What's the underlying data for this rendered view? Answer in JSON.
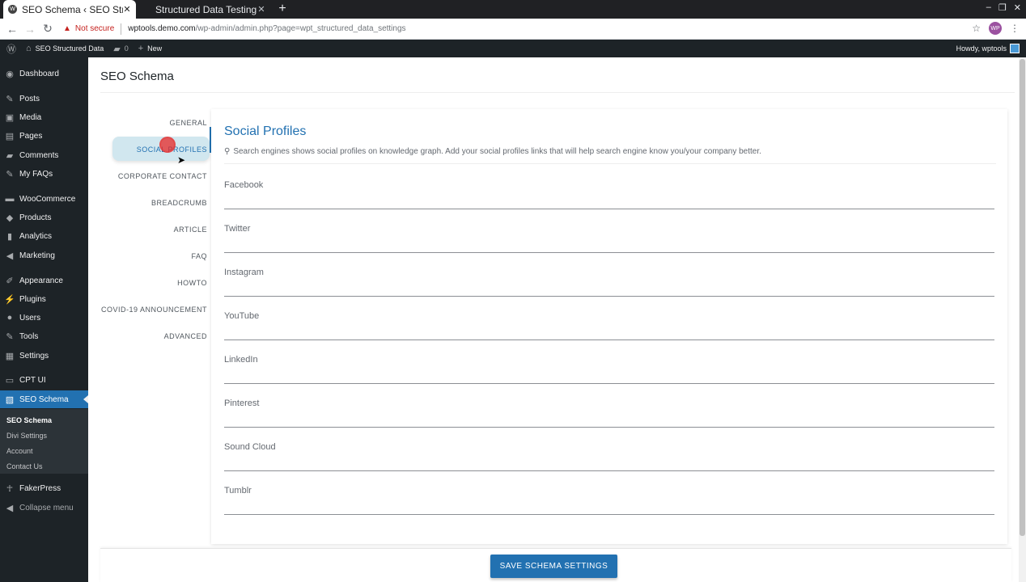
{
  "browser": {
    "tabs": [
      {
        "title": "SEO Schema ‹ SEO Struc",
        "active": true
      },
      {
        "title": "Structured Data Testing",
        "active": false
      }
    ],
    "new_tab_icon": "+",
    "security_label": "Not secure",
    "url_host": "wptools.demo.com",
    "url_path": "/wp-admin/admin.php?page=wpt_structured_data_settings",
    "profile_badge": "WP"
  },
  "adminbar": {
    "site_name": "SEO Structured Data",
    "comments_count": "0",
    "new_label": "New",
    "howdy": "Howdy, wptools"
  },
  "sidebar": {
    "items": [
      {
        "label": "Dashboard",
        "icon": "dashboard-icon"
      },
      {
        "label": "Posts",
        "icon": "pin-icon"
      },
      {
        "label": "Media",
        "icon": "media-icon"
      },
      {
        "label": "Pages",
        "icon": "page-icon"
      },
      {
        "label": "Comments",
        "icon": "comment-icon"
      },
      {
        "label": "My FAQs",
        "icon": "pin-icon"
      },
      {
        "label": "WooCommerce",
        "icon": "woocommerce-icon"
      },
      {
        "label": "Products",
        "icon": "products-icon"
      },
      {
        "label": "Analytics",
        "icon": "analytics-icon"
      },
      {
        "label": "Marketing",
        "icon": "megaphone-icon"
      },
      {
        "label": "Appearance",
        "icon": "brush-icon"
      },
      {
        "label": "Plugins",
        "icon": "plugin-icon"
      },
      {
        "label": "Users",
        "icon": "users-icon"
      },
      {
        "label": "Tools",
        "icon": "wrench-icon"
      },
      {
        "label": "Settings",
        "icon": "settings-icon"
      },
      {
        "label": "CPT UI",
        "icon": "cpt-icon"
      },
      {
        "label": "SEO Schema",
        "icon": "schema-icon"
      }
    ],
    "submenu": [
      "SEO Schema",
      "Divi Settings",
      "Account",
      "Contact Us"
    ],
    "after": [
      {
        "label": "FakerPress",
        "icon": "person-icon"
      },
      {
        "label": "Collapse menu",
        "icon": "collapse-icon"
      }
    ]
  },
  "page": {
    "title": "SEO Schema",
    "vtabs": [
      "GENERAL",
      "SOCIAL PROFILES",
      "CORPORATE CONTACT",
      "BREADCRUMB",
      "ARTICLE",
      "FAQ",
      "HOWTO",
      "COVID-19 ANNOUNCEMENT",
      "ADVANCED"
    ],
    "active_vtab": "SOCIAL PROFILES"
  },
  "panel": {
    "title": "Social Profiles",
    "description": "Search engines shows social profiles on knowledge graph. Add your social profiles links that will help search engine know you/your company better.",
    "fields": [
      {
        "label": "Facebook",
        "value": ""
      },
      {
        "label": "Twitter",
        "value": ""
      },
      {
        "label": "Instagram",
        "value": ""
      },
      {
        "label": "YouTube",
        "value": ""
      },
      {
        "label": "LinkedIn",
        "value": ""
      },
      {
        "label": "Pinterest",
        "value": ""
      },
      {
        "label": "Sound Cloud",
        "value": ""
      },
      {
        "label": "Tumblr",
        "value": ""
      }
    ],
    "save_label": "SAVE SCHEMA SETTINGS"
  },
  "colors": {
    "accent": "#2271b1",
    "admin_dark": "#1d2327"
  }
}
